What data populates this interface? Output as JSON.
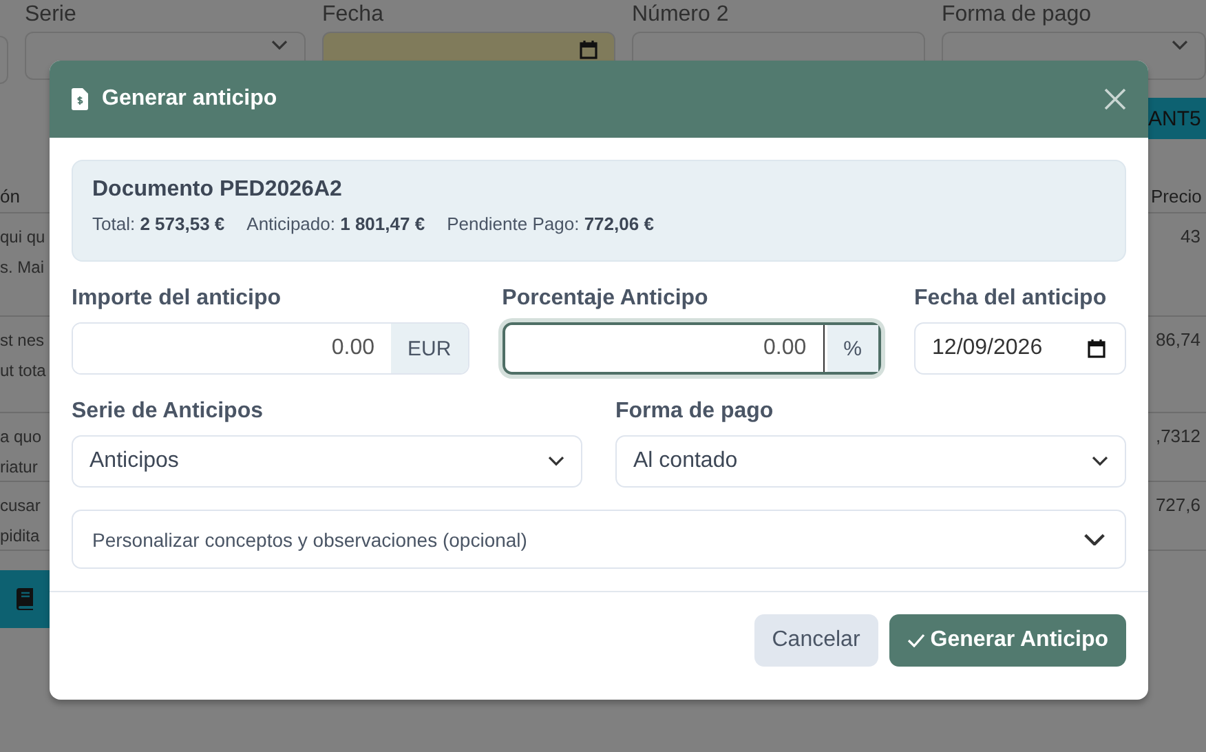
{
  "background": {
    "form_fields": [
      {
        "label": "Serie",
        "kind": "select"
      },
      {
        "label": "Fecha",
        "kind": "date"
      },
      {
        "label": "Número 2",
        "kind": "text"
      },
      {
        "label": "Forma de pago",
        "kind": "select"
      }
    ],
    "button": "ANT5",
    "table": {
      "columns": [
        "ón",
        "Precio"
      ],
      "rows": [
        {
          "description": [
            "qui qu",
            "s. Mai"
          ],
          "price": "43"
        },
        {
          "description": [
            "st nes",
            "ut tota"
          ],
          "price": "86,74"
        },
        {
          "description": [
            "a quo",
            "riatur"
          ],
          "price": ",7312"
        },
        {
          "description": [
            "cusar",
            "pidita"
          ],
          "price": "727,6"
        }
      ]
    }
  },
  "modal": {
    "title": "Generar anticipo",
    "document": {
      "title": "Documento PED2026A2",
      "amounts": [
        {
          "label": "Total:",
          "value": "2 573,53 €"
        },
        {
          "label": "Anticipado:",
          "value": "1 801,47 €"
        },
        {
          "label": "Pendiente Pago:",
          "value": "772,06 €"
        }
      ]
    },
    "fields": [
      {
        "label": "Importe del anticipo",
        "value": "0.00",
        "suffix": "EUR",
        "kind": "number",
        "focused": false
      },
      {
        "label": "Porcentaje Anticipo",
        "value": "0.00",
        "suffix": "%",
        "kind": "number",
        "focused": true
      },
      {
        "label": "Fecha del anticipo",
        "value": "12/09/2026",
        "kind": "date",
        "focused": false
      }
    ],
    "selects": [
      {
        "label": "Serie de Anticipos",
        "value": "Anticipos"
      },
      {
        "label": "Forma de pago",
        "value": "Al contado"
      }
    ],
    "accordion": {
      "label": "Personalizar conceptos y observaciones (opcional)",
      "expanded": false
    },
    "buttons": [
      {
        "label": "Cancelar",
        "kind": "secondary"
      },
      {
        "label": "Generar Anticipo",
        "kind": "primary"
      }
    ]
  }
}
